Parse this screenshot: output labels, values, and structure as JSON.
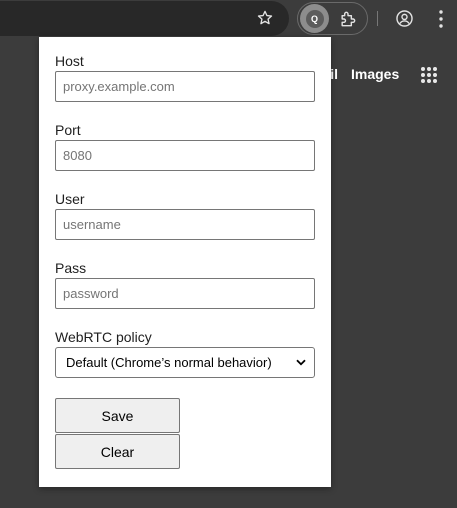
{
  "browser": {
    "icons": {
      "bookmark": "star-icon",
      "extension_active": "proxy-extension-icon",
      "extension_letter": "Q",
      "extensions": "puzzle-icon",
      "profile": "profile-icon",
      "menu": "kebab-menu-icon"
    },
    "page": {
      "link_partial": "Gmail",
      "link_images": "Images",
      "apps_icon": "apps-grid-icon"
    }
  },
  "popup": {
    "host": {
      "label": "Host",
      "value": "",
      "placeholder": "proxy.example.com"
    },
    "port": {
      "label": "Port",
      "value": "",
      "placeholder": "8080"
    },
    "user": {
      "label": "User",
      "value": "",
      "placeholder": "username"
    },
    "pass": {
      "label": "Pass",
      "value": "",
      "placeholder": "password"
    },
    "webrtc": {
      "label": "WebRTC policy",
      "selected": "Default (Chrome’s normal behavior)"
    },
    "save_label": "Save",
    "clear_label": "Clear"
  },
  "colors": {
    "toolbar_bg": "#3c3c3c",
    "omnibox_bg": "#282828",
    "popup_bg": "#ffffff",
    "button_bg": "#efefef",
    "border": "#767676"
  }
}
